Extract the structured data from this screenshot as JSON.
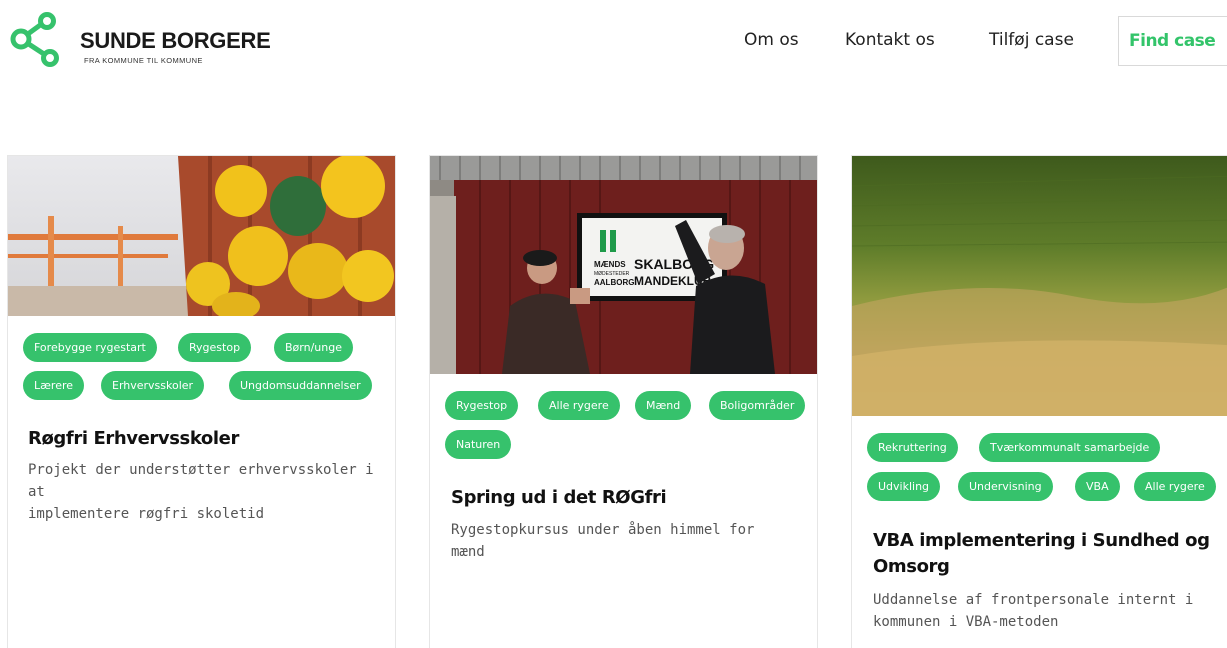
{
  "brand": {
    "title": "SUNDE BORGERE",
    "subtitle": "FRA KOMMUNE TIL KOMMUNE",
    "logo_icon": "network-nodes-icon",
    "accent_color": "#36c26c"
  },
  "nav": {
    "om_os": "Om os",
    "kontakt_os": "Kontakt os",
    "tilfoej_case": "Tilføj case",
    "find_case": "Find case"
  },
  "cards": [
    {
      "image": "hard-hats-on-container-photo",
      "tags": [
        "Forebygge rygestart",
        "Rygestop",
        "Børn/unge",
        "Lærere",
        "Erhvervsskoler",
        "Ungdomsuddannelser"
      ],
      "title": "Røgfri Erhvervsskoler",
      "description_lines": [
        "Projekt der understøtter erhvervsskoler i at",
        "implementere røgfri skoletid"
      ]
    },
    {
      "image": "men-hanging-club-sign-photo",
      "sign_text": [
        "MÆNDS",
        "SKALBORG",
        "MØDESTEDER",
        "AALBORG",
        "MANDEKLUB"
      ],
      "tags": [
        "Rygestop",
        "Alle rygere",
        "Mænd",
        "Boligområder",
        "Naturen"
      ],
      "title": "Spring ud i det RØGfri",
      "description_lines": [
        "Rygestopkursus under åben himmel for",
        "mænd"
      ]
    },
    {
      "image": "green-and-golden-field-photo",
      "tags": [
        "Rekruttering",
        "Tværkommunalt samarbejde",
        "Udvikling",
        "Undervisning",
        "VBA",
        "Alle rygere"
      ],
      "title_lines": [
        "VBA implementering i Sundhed og",
        "Omsorg"
      ],
      "description_lines": [
        "Uddannelse af frontpersonale internt i",
        "kommunen i VBA-metoden"
      ]
    }
  ]
}
